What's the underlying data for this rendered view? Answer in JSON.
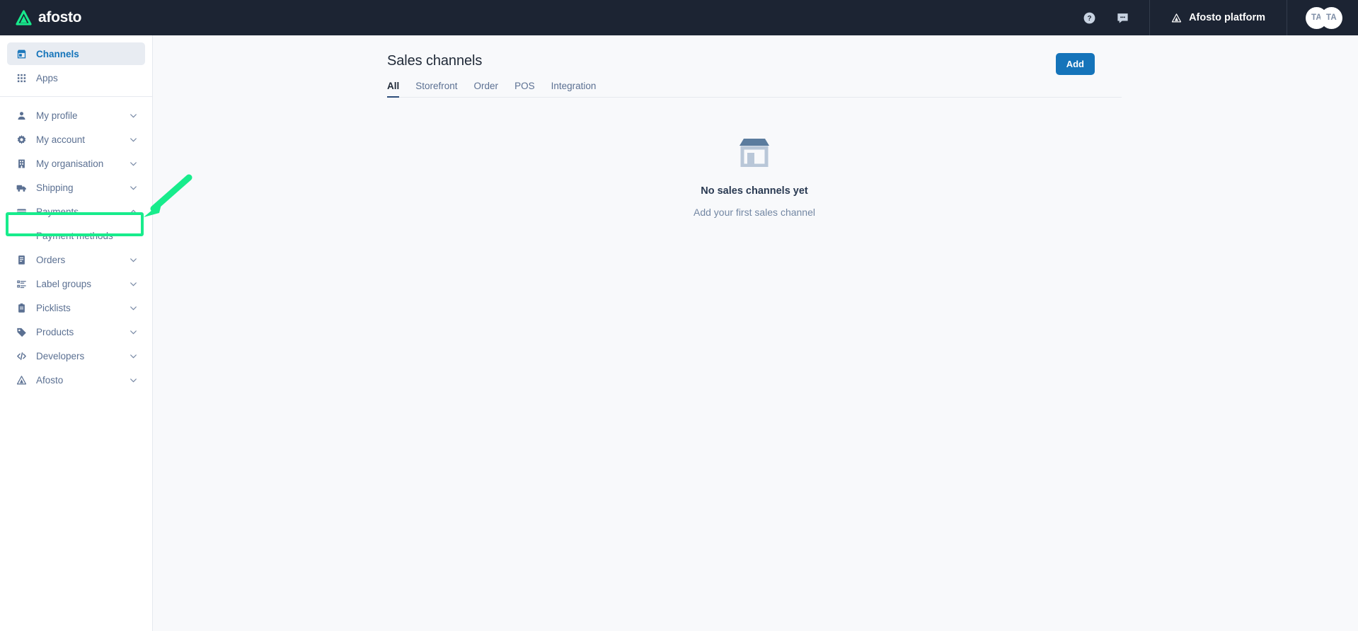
{
  "topbar": {
    "brand_name": "afosto",
    "brand_icon": "afosto-triangle-logo",
    "help_icon": "question-circle-icon",
    "chat_icon": "chat-bubble-icon",
    "platform_label": "Afosto platform",
    "platform_icon": "afosto-triangle-icon",
    "avatars": [
      {
        "initials": "TA"
      },
      {
        "initials": "TA"
      }
    ]
  },
  "sidebar": {
    "top_items": [
      {
        "label": "Channels",
        "icon": "storefront-icon",
        "active": true
      },
      {
        "label": "Apps",
        "icon": "grid-apps-icon",
        "active": false
      }
    ],
    "groups": [
      {
        "label": "My profile",
        "icon": "user-icon",
        "expanded": false
      },
      {
        "label": "My account",
        "icon": "gear-icon",
        "expanded": false
      },
      {
        "label": "My organisation",
        "icon": "building-icon",
        "expanded": false
      },
      {
        "label": "Shipping",
        "icon": "truck-icon",
        "expanded": false
      },
      {
        "label": "Payments",
        "icon": "credit-card-icon",
        "expanded": true
      },
      {
        "label": "Orders",
        "icon": "receipt-icon",
        "expanded": false
      },
      {
        "label": "Label groups",
        "icon": "label-list-icon",
        "expanded": false
      },
      {
        "label": "Picklists",
        "icon": "clipboard-icon",
        "expanded": false
      },
      {
        "label": "Products",
        "icon": "tag-icon",
        "expanded": false
      },
      {
        "label": "Developers",
        "icon": "code-icon",
        "expanded": false
      },
      {
        "label": "Afosto",
        "icon": "afosto-triangle-icon",
        "expanded": false
      }
    ],
    "payments_submenu": [
      {
        "label": "Payment methods",
        "highlighted": true
      }
    ]
  },
  "main": {
    "page_title": "Sales channels",
    "add_label": "Add",
    "tabs": [
      {
        "label": "All",
        "active": true
      },
      {
        "label": "Storefront",
        "active": false
      },
      {
        "label": "Order",
        "active": false
      },
      {
        "label": "POS",
        "active": false
      },
      {
        "label": "Integration",
        "active": false
      }
    ],
    "empty_state": {
      "icon": "storefront-icon",
      "title": "No sales channels yet",
      "subtitle": "Add your first sales channel"
    }
  },
  "annotation": {
    "color": "#18ec8c",
    "target": "Payment methods",
    "shapes": [
      "highlight-box",
      "pointer-arrow"
    ]
  }
}
